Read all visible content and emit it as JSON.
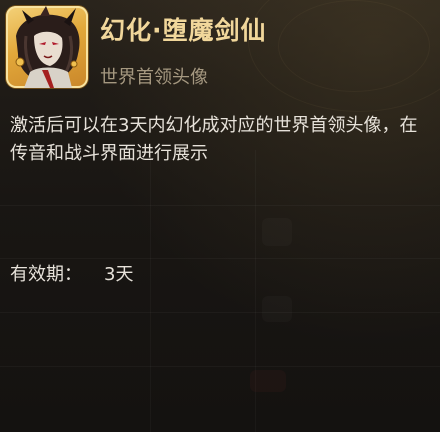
{
  "item": {
    "title": "幻化·堕魔剑仙",
    "subtitle": "世界首领头像",
    "avatar_icon": "boss-portrait-icon",
    "description": "激活后可以在3天内幻化成对应的世界首领头像，在传音和战斗界面进行展示",
    "validity_label": "有效期：",
    "validity_value": "3天"
  },
  "colors": {
    "title": "#f1d79b",
    "subtitle": "#a59880",
    "text": "#e7e2da",
    "frame_gold": "#e2a83a",
    "background": "#1f1b16"
  }
}
